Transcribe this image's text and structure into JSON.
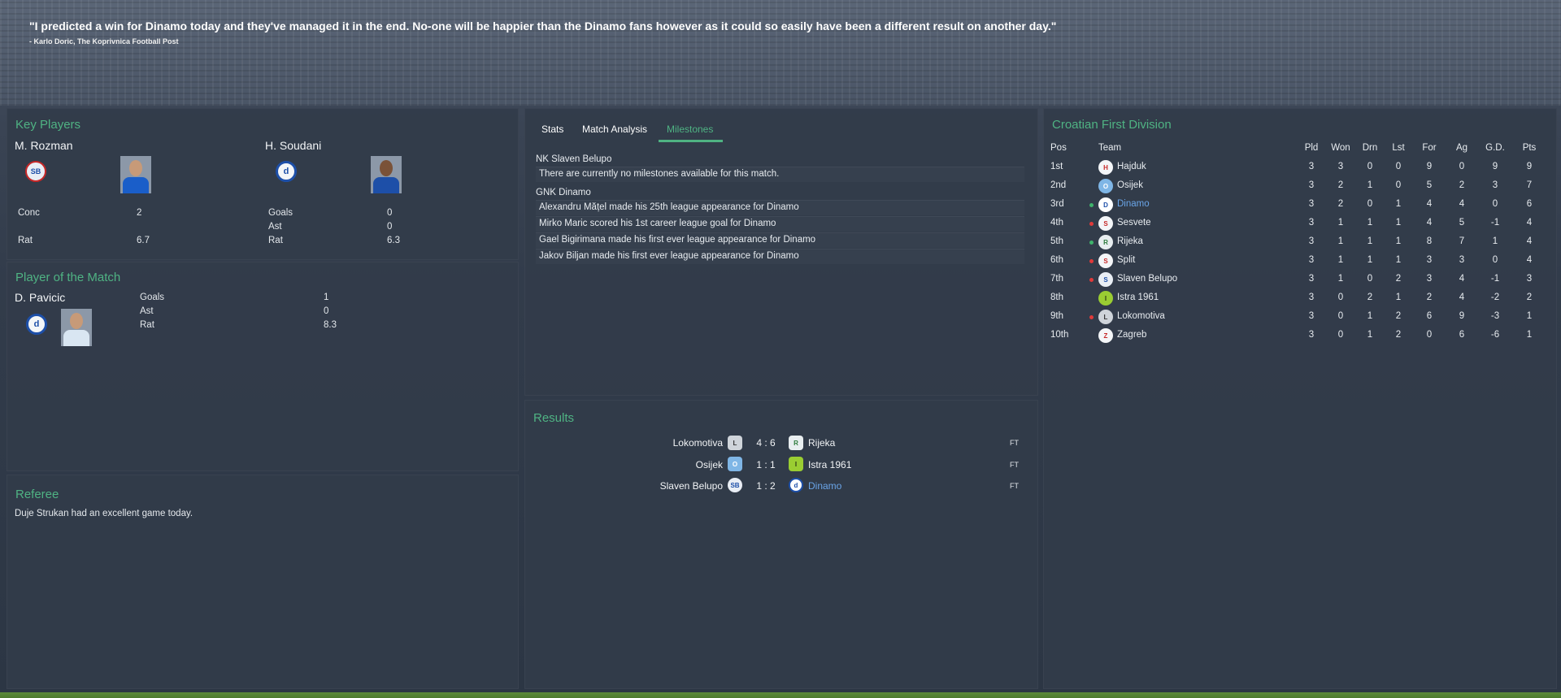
{
  "quote": {
    "text": "\"I predicted a win for Dinamo today and they've managed it in the end. No-one will be happier than the Dinamo fans however as it could so easily have been a different result on another day.\"",
    "author": "- Karlo Doric, The Koprivnica Football Post"
  },
  "key_players": {
    "title": "Key Players",
    "players": [
      {
        "name": "M. Rozman",
        "stats": [
          {
            "label": "Conc",
            "value": "2"
          },
          {
            "label": "Rat",
            "value": "6.7"
          }
        ]
      },
      {
        "name": "H. Soudani",
        "stats": [
          {
            "label": "Goals",
            "value": "0"
          },
          {
            "label": "Ast",
            "value": "0"
          },
          {
            "label": "Rat",
            "value": "6.3"
          }
        ]
      }
    ]
  },
  "potm": {
    "title": "Player of the Match",
    "name": "D. Pavicic",
    "stats": [
      {
        "label": "Goals",
        "value": "1"
      },
      {
        "label": "Ast",
        "value": "0"
      },
      {
        "label": "Rat",
        "value": "8.3"
      }
    ]
  },
  "referee": {
    "title": "Referee",
    "text": "Duje Strukan had an excellent game today."
  },
  "tabs": [
    "Stats",
    "Match Analysis",
    "Milestones"
  ],
  "milestones": {
    "team1": "NK Slaven Belupo",
    "team1_items": [
      "There are currently no milestones available for this match."
    ],
    "team2": "GNK Dinamo",
    "team2_items": [
      "Alexandru Mățel made his 25th league appearance for Dinamo",
      "Mirko Maric scored his 1st career league goal for Dinamo",
      "Gael Bigirimana made his first ever league appearance for Dinamo",
      "Jakov Biljan made his first ever league appearance for Dinamo"
    ]
  },
  "results": {
    "title": "Results",
    "rows": [
      {
        "home": "Lokomotiva",
        "score": "4 : 6",
        "away": "Rijeka",
        "status": "FT"
      },
      {
        "home": "Osijek",
        "score": "1 : 1",
        "away": "Istra 1961",
        "status": "FT"
      },
      {
        "home": "Slaven Belupo",
        "score": "1 : 2",
        "away": "Dinamo",
        "status": "FT"
      }
    ]
  },
  "league": {
    "title": "Croatian First Division",
    "headers": [
      "Pos",
      "Team",
      "Pld",
      "Won",
      "Drn",
      "Lst",
      "For",
      "Ag",
      "G.D.",
      "Pts"
    ],
    "rows": [
      {
        "pos": "1st",
        "team": "Hajduk",
        "pld": "3",
        "won": "3",
        "drn": "0",
        "lst": "0",
        "for": "9",
        "ag": "0",
        "gd": "9",
        "pts": "9",
        "move": ""
      },
      {
        "pos": "2nd",
        "team": "Osijek",
        "pld": "3",
        "won": "2",
        "drn": "1",
        "lst": "0",
        "for": "5",
        "ag": "2",
        "gd": "3",
        "pts": "7",
        "move": ""
      },
      {
        "pos": "3rd",
        "team": "Dinamo",
        "pld": "3",
        "won": "2",
        "drn": "0",
        "lst": "1",
        "for": "4",
        "ag": "4",
        "gd": "0",
        "pts": "6",
        "move": "up"
      },
      {
        "pos": "4th",
        "team": "Sesvete",
        "pld": "3",
        "won": "1",
        "drn": "1",
        "lst": "1",
        "for": "4",
        "ag": "5",
        "gd": "-1",
        "pts": "4",
        "move": "down"
      },
      {
        "pos": "5th",
        "team": "Rijeka",
        "pld": "3",
        "won": "1",
        "drn": "1",
        "lst": "1",
        "for": "8",
        "ag": "7",
        "gd": "1",
        "pts": "4",
        "move": "up"
      },
      {
        "pos": "6th",
        "team": "Split",
        "pld": "3",
        "won": "1",
        "drn": "1",
        "lst": "1",
        "for": "3",
        "ag": "3",
        "gd": "0",
        "pts": "4",
        "move": "down"
      },
      {
        "pos": "7th",
        "team": "Slaven Belupo",
        "pld": "3",
        "won": "1",
        "drn": "0",
        "lst": "2",
        "for": "3",
        "ag": "4",
        "gd": "-1",
        "pts": "3",
        "move": "down"
      },
      {
        "pos": "8th",
        "team": "Istra 1961",
        "pld": "3",
        "won": "0",
        "drn": "2",
        "lst": "1",
        "for": "2",
        "ag": "4",
        "gd": "-2",
        "pts": "2",
        "move": ""
      },
      {
        "pos": "9th",
        "team": "Lokomotiva",
        "pld": "3",
        "won": "0",
        "drn": "1",
        "lst": "2",
        "for": "6",
        "ag": "9",
        "gd": "-3",
        "pts": "1",
        "move": "down"
      },
      {
        "pos": "10th",
        "team": "Zagreb",
        "pld": "3",
        "won": "0",
        "drn": "1",
        "lst": "2",
        "for": "0",
        "ag": "6",
        "gd": "-6",
        "pts": "1",
        "move": ""
      }
    ]
  },
  "colors": {
    "accent": "#4fb383",
    "highlight": "#6aa5e8",
    "up": "#3fb36b",
    "down": "#e03a3a"
  }
}
